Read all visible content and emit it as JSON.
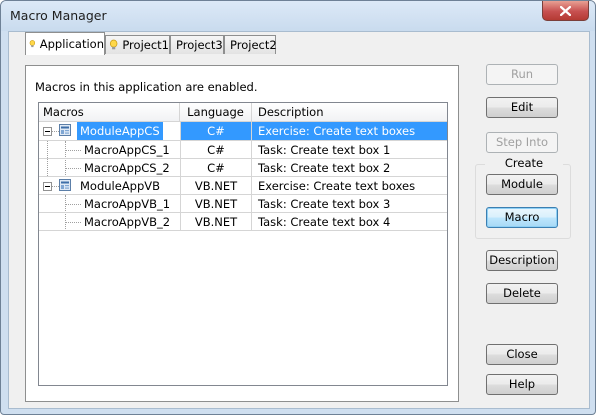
{
  "window": {
    "title": "Macro Manager"
  },
  "tabs": [
    {
      "label": "Application",
      "active": true,
      "icon": "lightbulb-icon"
    },
    {
      "label": "Project1",
      "active": false,
      "icon": "lightbulb-icon"
    },
    {
      "label": "Project3",
      "active": false
    },
    {
      "label": "Project2",
      "active": false
    }
  ],
  "status_text": "Macros in this application are enabled.",
  "table": {
    "columns": [
      "Macros",
      "Language",
      "Description"
    ],
    "rows": [
      {
        "name": "ModuleAppCS",
        "language": "C#",
        "description": "Exercise: Create text boxes",
        "type": "module",
        "selected": true
      },
      {
        "name": "MacroAppCS_1",
        "language": "C#",
        "description": "Task: Create text box 1",
        "type": "macro"
      },
      {
        "name": "MacroAppCS_2",
        "language": "C#",
        "description": "Task: Create text box 2",
        "type": "macro"
      },
      {
        "name": "ModuleAppVB",
        "language": "VB.NET",
        "description": "Exercise: Create text boxes",
        "type": "module"
      },
      {
        "name": "MacroAppVB_1",
        "language": "VB.NET",
        "description": "Task: Create text box 3",
        "type": "macro"
      },
      {
        "name": "MacroAppVB_2",
        "language": "VB.NET",
        "description": "Task: Create text box 4",
        "type": "macro"
      }
    ]
  },
  "buttons": {
    "run": "Run",
    "edit": "Edit",
    "step_into": "Step Into",
    "create_group": "Create",
    "module": "Module",
    "macro": "Macro",
    "description": "Description",
    "delete": "Delete",
    "close": "Close",
    "help": "Help"
  },
  "colors": {
    "selection": "#3399ff",
    "close_button": "#c75050"
  }
}
